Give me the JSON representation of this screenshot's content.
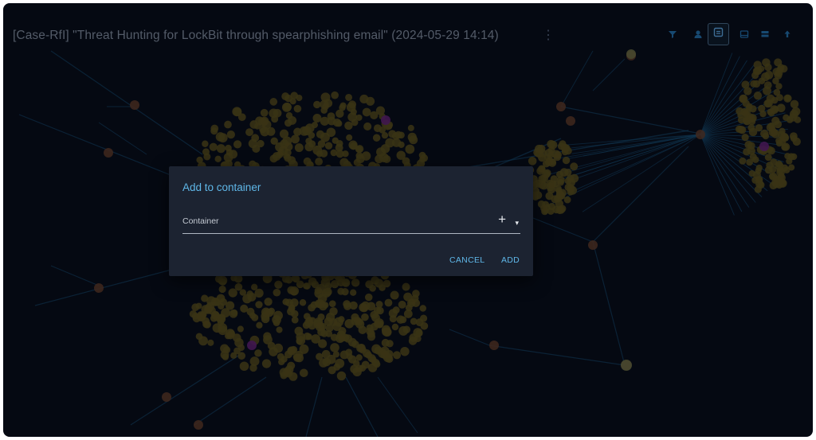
{
  "window": {
    "title": "[Case-RfI] \"Threat Hunting for LockBit through spearphishing email\" (2024-05-29 14:14)"
  },
  "toolbar": {
    "icons": [
      "filter-icon",
      "user-icon",
      "add-to-container-icon",
      "report-icon",
      "stack-icon",
      "upload-icon"
    ],
    "accent": "#1d5a8a"
  },
  "dialog": {
    "title": "Add to container",
    "field_label": "Container",
    "add_symbol": "+",
    "dropdown_symbol": "▾",
    "cancel_label": "CANCEL",
    "add_label": "ADD",
    "accent": "#5fb7e8"
  },
  "colors": {
    "background": "#070b17",
    "node": "#7a6a1c",
    "edge": "#1d6a99",
    "highlight_node": "#8a2a9e"
  }
}
